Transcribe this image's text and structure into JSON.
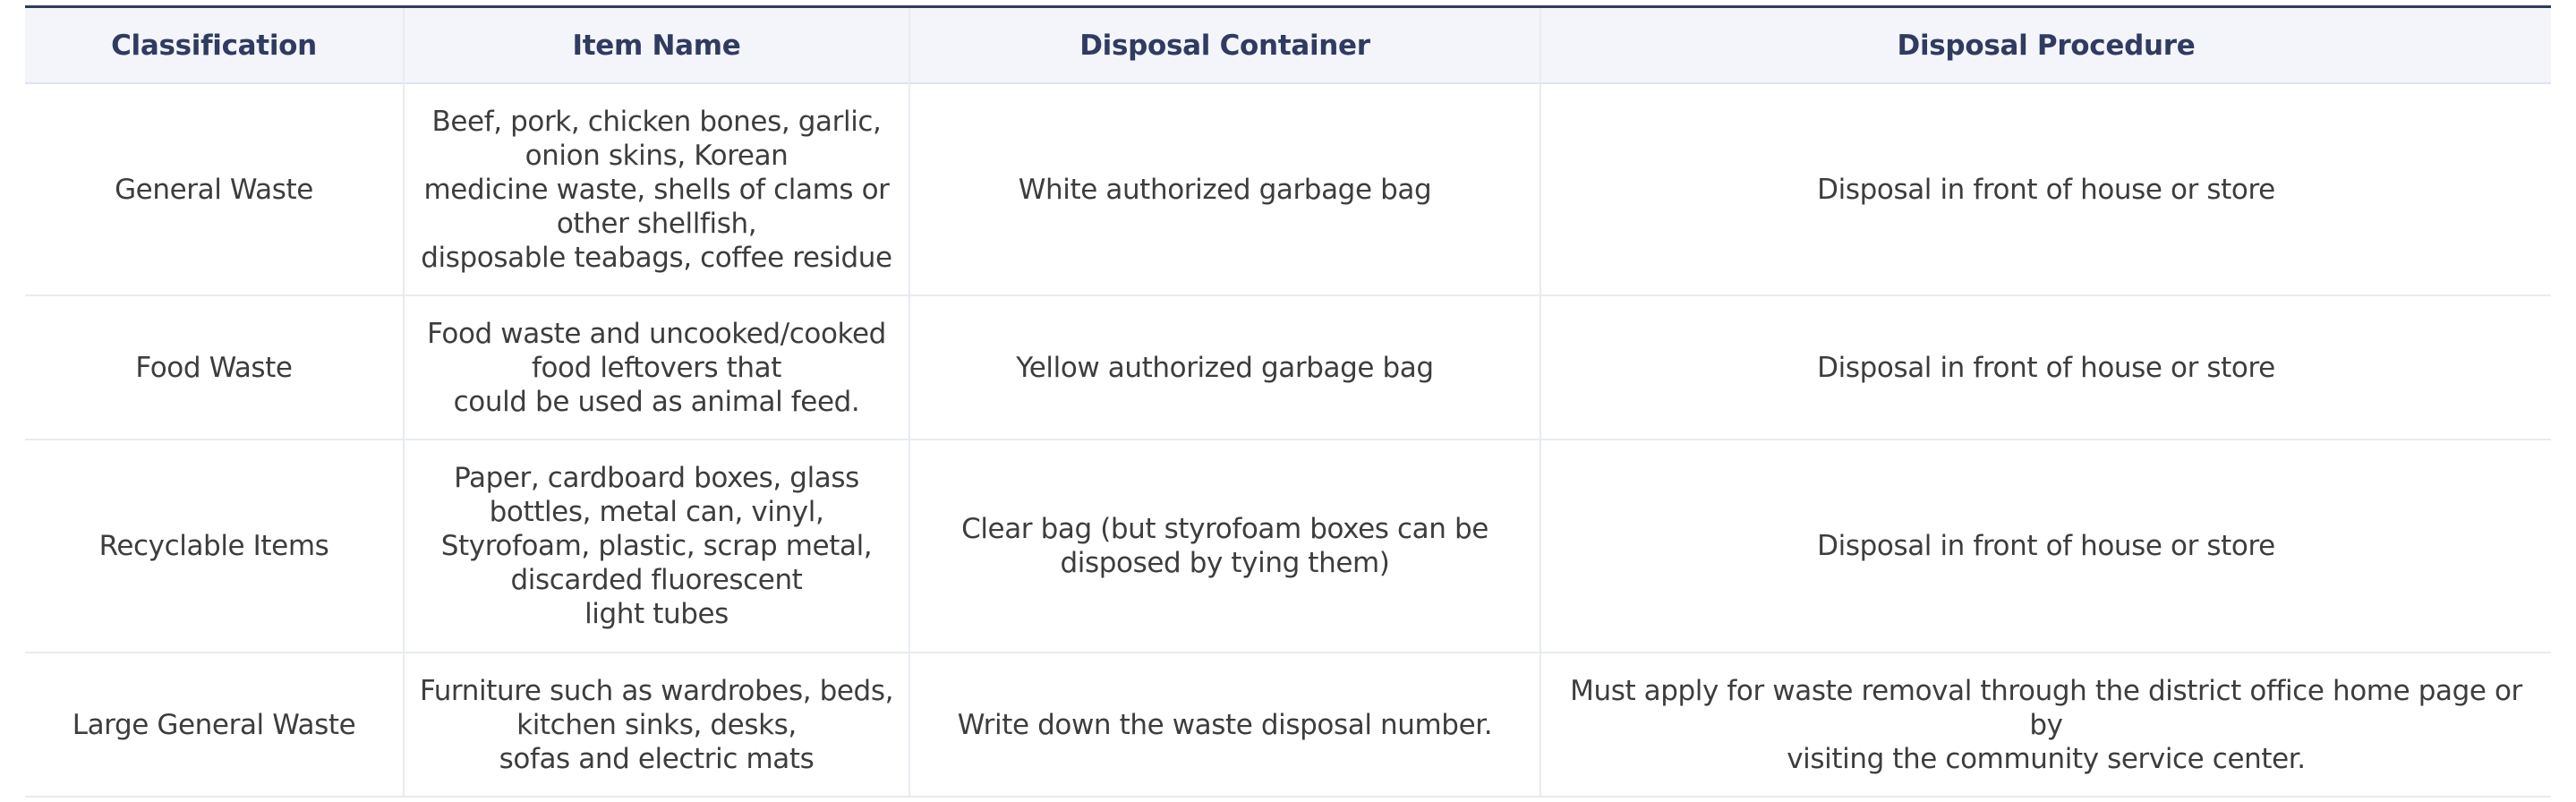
{
  "table": {
    "headers": [
      "Classification",
      "Item Name",
      "Disposal Container",
      "Disposal Procedure"
    ],
    "rows": [
      {
        "classification": "General Waste",
        "item_lines": [
          "Beef, pork, chicken bones, garlic,",
          "onion skins, Korean",
          "medicine waste, shells of clams or",
          "other shellfish,",
          "disposable teabags, coffee residue"
        ],
        "container_lines": [
          "White authorized garbage bag"
        ],
        "procedure_lines": [
          "Disposal in front of house or store"
        ]
      },
      {
        "classification": "Food Waste",
        "item_lines": [
          "Food waste and uncooked/cooked",
          "food leftovers that",
          "could be used as animal feed."
        ],
        "container_lines": [
          "Yellow authorized garbage bag"
        ],
        "procedure_lines": [
          "Disposal in front of house or store"
        ]
      },
      {
        "classification": "Recyclable Items",
        "item_lines": [
          "Paper, cardboard boxes, glass",
          "bottles, metal can, vinyl,",
          "Styrofoam, plastic, scrap metal,",
          "discarded fluorescent",
          "light tubes"
        ],
        "container_lines": [
          "Clear bag (but styrofoam boxes can be",
          "disposed by tying them)"
        ],
        "procedure_lines": [
          "Disposal in front of house or store"
        ]
      },
      {
        "classification": "Large General Waste",
        "item_lines": [
          "Furniture such as wardrobes, beds,",
          "kitchen sinks, desks,",
          "sofas and electric mats"
        ],
        "container_lines": [
          "Write down the waste disposal number."
        ],
        "procedure_lines": [
          "Must apply for waste removal through the district office home page or by",
          "visiting the community service center."
        ]
      }
    ]
  }
}
